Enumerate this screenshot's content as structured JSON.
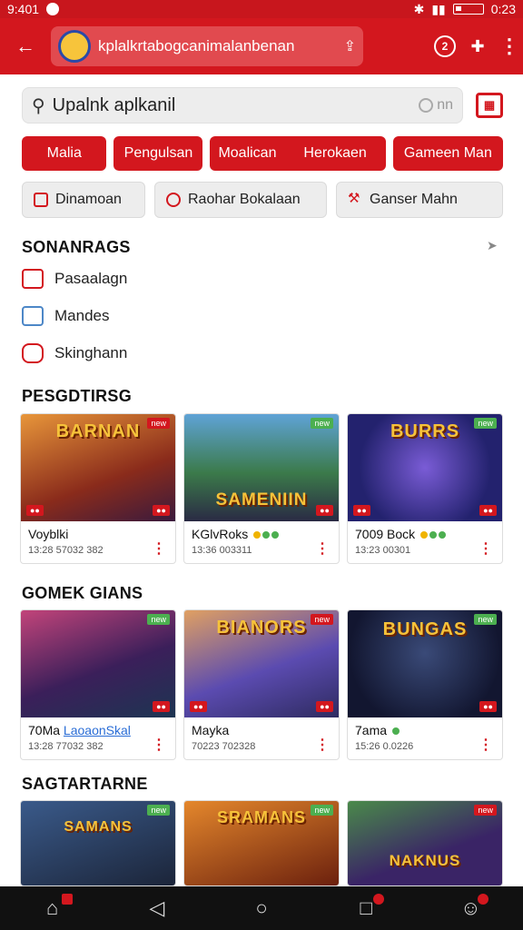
{
  "status": {
    "time": "9:401",
    "right_time": "0:23"
  },
  "appbar": {
    "url": "kplalkrtabogcanimalanbenan"
  },
  "search": {
    "text": "Upalnk aplkanil",
    "mic_text": "nn"
  },
  "chips": [
    "Malia",
    "Pengulsan",
    "Moalican",
    "Herokaen",
    "Gameen Man"
  ],
  "chips2": [
    "Dinamoan",
    "Raohar Bokalaan",
    "Ganser Mahn"
  ],
  "sections": {
    "s1": "SONANRAGS",
    "s2": "PESGDTIRSG",
    "s3": "GOMEK GIANS",
    "s4": "SAGTARTARNE"
  },
  "menu": [
    "Pasaalagn",
    "Mandes",
    "Skinghann"
  ],
  "row1": [
    {
      "thumb_title": "BARNAN",
      "name": "Voyblki",
      "meta": "13:28   57032 382",
      "bg": "#c4572c"
    },
    {
      "thumb_title": "SAMENIIN",
      "name": "KGlvRoks",
      "meta": "13:36   003311",
      "bg": "#3c6d8f"
    },
    {
      "thumb_title": "BURRS",
      "name": "7009 Bock",
      "meta": "13:23   00301",
      "bg": "#3b2f88"
    }
  ],
  "row2": [
    {
      "thumb_title": "",
      "name": "70Ma",
      "link": "LaoaonSkal",
      "meta": "13:28   77032 382",
      "bg": "#6a2a5c"
    },
    {
      "thumb_title": "BIANORS",
      "name": "Mayka",
      "meta": "70223   702328",
      "bg": "#4a4f9a"
    },
    {
      "thumb_title": "BUNGAS",
      "name": "7ama",
      "meta": "15:26   0.0226",
      "bg": "#1f2848"
    }
  ],
  "row3": [
    {
      "thumb_title": "SAMANS",
      "bg": "#2a3b57"
    },
    {
      "thumb_title": "SRAMANS",
      "bg": "#7a2c10"
    },
    {
      "thumb_title": "NAKNUS",
      "bg": "#3f2c6b"
    }
  ]
}
